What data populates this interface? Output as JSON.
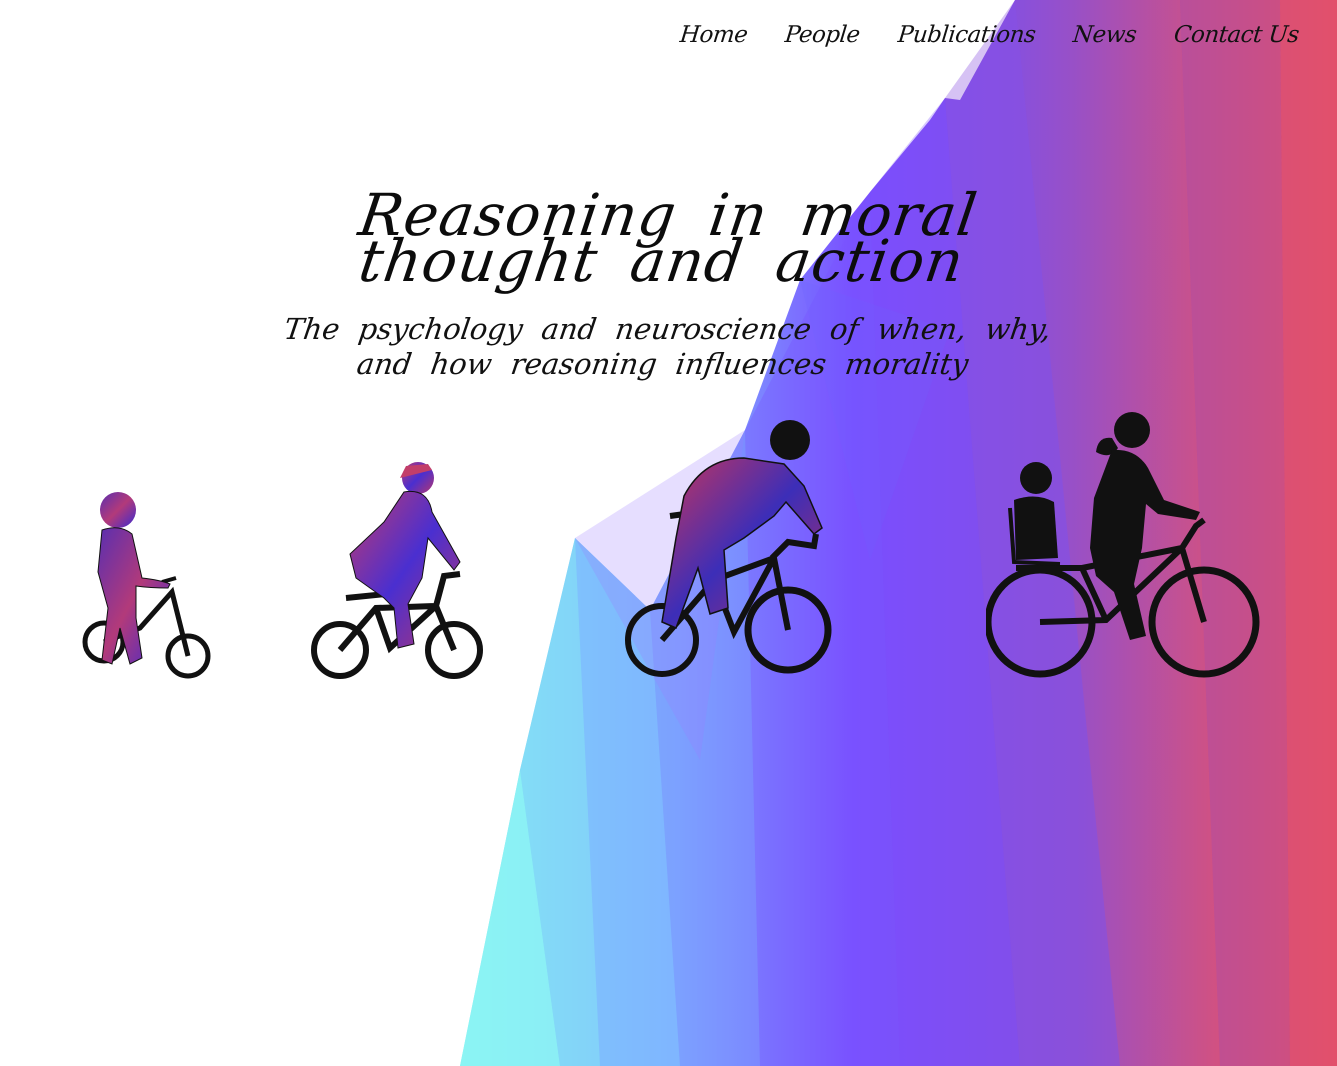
{
  "nav": {
    "items": [
      {
        "label": "Home",
        "icon": null
      },
      {
        "label": "People"
      },
      {
        "label": "Publications"
      },
      {
        "label": "News"
      },
      {
        "label": "Contact Us"
      }
    ]
  },
  "hero": {
    "title": "Reasoning in moral thought and action",
    "subtitle": "The psychology and neuroscience of when, why, and how reasoning influences morality"
  },
  "illustrations": [
    {
      "icon": "toddler-balance-bike-icon"
    },
    {
      "icon": "child-bicycle-icon"
    },
    {
      "icon": "adult-road-bike-icon"
    },
    {
      "icon": "parent-child-bicycle-icon"
    }
  ],
  "colors": {
    "cyan": "#7ff2f2",
    "blue": "#7f9dff",
    "violet": "#7a4dff",
    "purple": "#9c4fc6",
    "red": "#e2506b",
    "text": "#111111"
  }
}
